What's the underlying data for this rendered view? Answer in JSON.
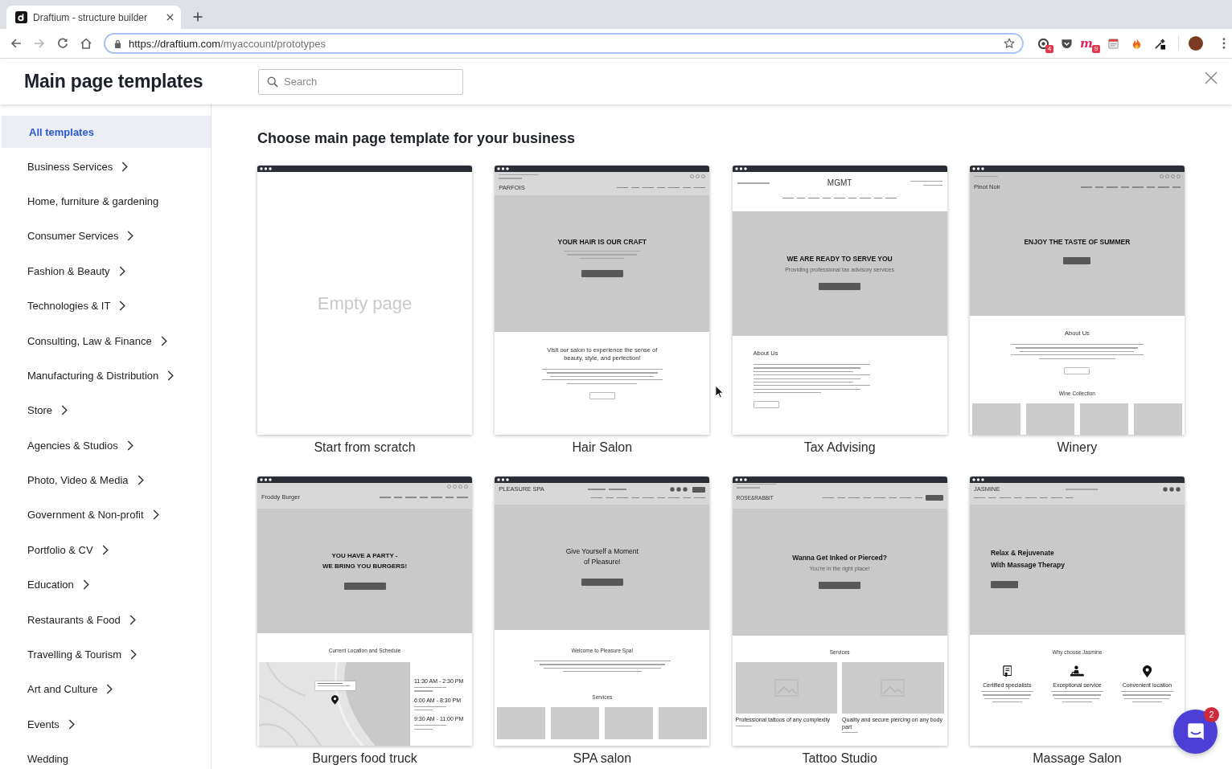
{
  "browser": {
    "tab": {
      "title": "Draftium - structure builder"
    },
    "address": {
      "host": "https://draftium.com",
      "path": "/myaccount/prototypes"
    },
    "extensions": [
      {
        "kind": "ring",
        "badge": "4"
      },
      {
        "kind": "shield"
      },
      {
        "kind": "letter",
        "glyph": "m",
        "badge": "9"
      },
      {
        "kind": "note"
      },
      {
        "kind": "flame"
      },
      {
        "kind": "dropper"
      }
    ]
  },
  "header": {
    "title": "Main page templates",
    "search": {
      "placeholder": "Search"
    }
  },
  "sidebar": {
    "items": [
      {
        "label": "All templates",
        "selected": true,
        "has_submenu": false
      },
      {
        "label": "Business Services",
        "selected": false,
        "has_submenu": true
      },
      {
        "label": "Home, furniture & gardening",
        "selected": false,
        "has_submenu": false
      },
      {
        "label": "Consumer Services",
        "selected": false,
        "has_submenu": true
      },
      {
        "label": "Fashion & Beauty",
        "selected": false,
        "has_submenu": true
      },
      {
        "label": "Technologies & IT",
        "selected": false,
        "has_submenu": true
      },
      {
        "label": "Consulting, Law & Finance",
        "selected": false,
        "has_submenu": true
      },
      {
        "label": "Manufacturing & Distribution",
        "selected": false,
        "has_submenu": true
      },
      {
        "label": "Store",
        "selected": false,
        "has_submenu": true
      },
      {
        "label": "Agencies & Studios",
        "selected": false,
        "has_submenu": true
      },
      {
        "label": "Photo, Video & Media",
        "selected": false,
        "has_submenu": true
      },
      {
        "label": "Government & Non-profit",
        "selected": false,
        "has_submenu": true
      },
      {
        "label": "Portfolio & CV",
        "selected": false,
        "has_submenu": true
      },
      {
        "label": "Education",
        "selected": false,
        "has_submenu": true
      },
      {
        "label": "Restaurants & Food",
        "selected": false,
        "has_submenu": true
      },
      {
        "label": "Travelling & Tourism",
        "selected": false,
        "has_submenu": true
      },
      {
        "label": "Art and Culture",
        "selected": false,
        "has_submenu": true
      },
      {
        "label": "Events",
        "selected": false,
        "has_submenu": true
      },
      {
        "label": "Wedding",
        "selected": false,
        "has_submenu": false
      }
    ]
  },
  "main": {
    "heading": "Choose main page template for your business",
    "templates": [
      {
        "kind": "empty",
        "label": "Start from scratch",
        "caption": "Empty page"
      },
      {
        "kind": "salon",
        "label": "Hair Salon",
        "brand": "PARFOIS",
        "hero": [
          "YOUR HAIR IS OUR CRAFT"
        ],
        "section_heading": "Visit our salon to experience the sense of beauty, style, and perfection!"
      },
      {
        "kind": "agency",
        "label": "Tax Advising",
        "brand": "MGMT",
        "hero": [
          "WE ARE READY TO SERVE YOU"
        ],
        "hero_subtitle": "Providing professional tax advisory services",
        "section_heading": "About Us"
      },
      {
        "kind": "winery",
        "label": "Winery",
        "brand": "Pinot Noir",
        "hero": [
          "ENJOY THE TASTE OF SUMMER"
        ],
        "section_heading": "About Us",
        "collection_heading": "Wine Collection"
      },
      {
        "kind": "foodtruck",
        "label": "Burgers food truck",
        "brand": "Froddy Burger",
        "hero": [
          "YOU HAVE A PARTY -",
          "WE BRING YOU BURGERS!"
        ],
        "section_heading": "Current Location and Schedule",
        "schedule": [
          "11:30 AM - 2:30 PM",
          "6:00 AM - 8:30 PM",
          "9:30 AM - 11:00 PM"
        ]
      },
      {
        "kind": "spa",
        "label": "SPA salon",
        "brand": "PLEASURE SPA",
        "hero": [
          "Give Yourself a Moment",
          "of Pleasure!"
        ],
        "section_heading": "Welcome to Pleasure Spa!",
        "services_heading": "Services"
      },
      {
        "kind": "studio",
        "label": "Tattoo Studio",
        "brand": "ROSE&RABBIT",
        "hero": [
          "Wanna Get Inked or Pierced?"
        ],
        "hero_subtitle": "You're in the right place!",
        "section_heading": "Services",
        "services": [
          "Professional tattoos of any complexity",
          "Quality and secure piercing on any body part"
        ]
      },
      {
        "kind": "massage",
        "label": "Massage Salon",
        "brand": "JASMINE",
        "hero": [
          "Relax & Rejuvenate",
          "With Massage Therapy"
        ],
        "section_heading": "Why choose Jasmine",
        "features": [
          {
            "kind": "certificate",
            "title": "Certified specialists"
          },
          {
            "kind": "therapist",
            "title": "Exceptional service"
          },
          {
            "kind": "pin",
            "title": "Convenient location"
          }
        ]
      }
    ]
  },
  "chat": {
    "badge": "2"
  }
}
